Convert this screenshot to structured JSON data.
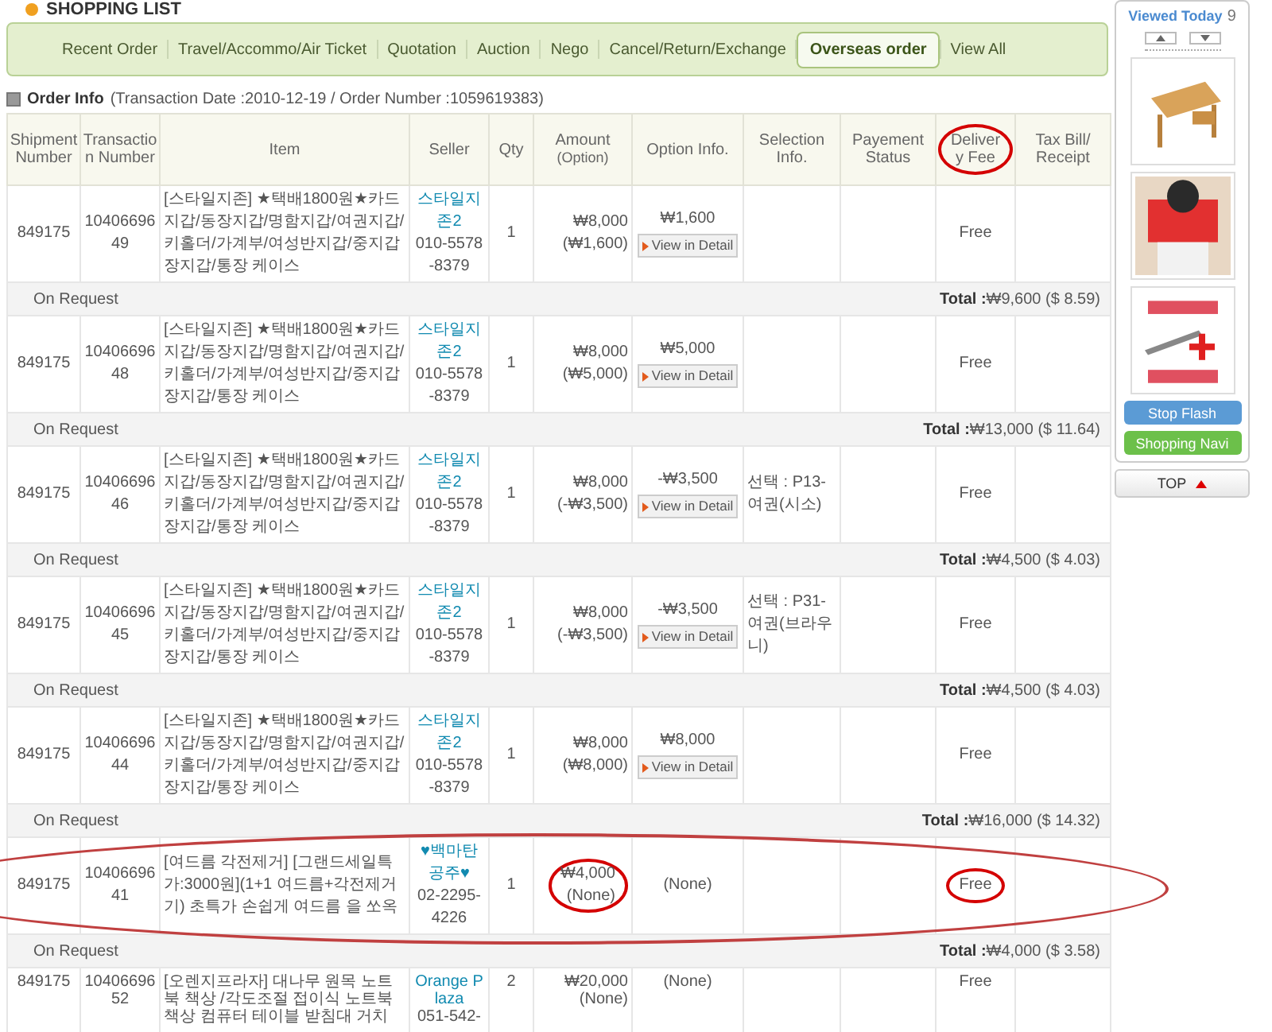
{
  "page_title": "SHOPPING LIST",
  "tabs": [
    {
      "label": "Recent Order",
      "selected": false
    },
    {
      "label": "Travel/Accommo/Air Ticket",
      "selected": false
    },
    {
      "label": "Quotation",
      "selected": false
    },
    {
      "label": "Auction",
      "selected": false
    },
    {
      "label": "Nego",
      "selected": false
    },
    {
      "label": "Cancel/Return/Exchange",
      "selected": false
    },
    {
      "label": "Overseas order",
      "selected": true
    },
    {
      "label": "View All",
      "selected": false
    }
  ],
  "order_info": {
    "label": "Order Info",
    "detail": "(Transaction Date :2010-12-19 / Order Number :1059619383)"
  },
  "columns": [
    {
      "label": "Shipment Number",
      "circled": false
    },
    {
      "label": "Transaction Number",
      "circled": false
    },
    {
      "label": "Item",
      "circled": false
    },
    {
      "label": "Seller",
      "circled": false
    },
    {
      "label": "Qty",
      "circled": false
    },
    {
      "label": "Amount",
      "sub": "(Option)",
      "circled": false
    },
    {
      "label": "Option Info.",
      "circled": false
    },
    {
      "label": "Selection Info.",
      "circled": false
    },
    {
      "label": "Payement Status",
      "circled": false
    },
    {
      "label": "Delivery Fee",
      "circled": true
    },
    {
      "label": "Tax Bill/ Receipt",
      "circled": false
    }
  ],
  "orders": [
    {
      "shipment": "849175",
      "transaction": "1040669649",
      "item": "[스타일지존] ★택배1800원★카드지갑/동장지갑/명함지갑/여권지갑/키홀더/가계부/여성반지갑/중지갑장지갑/통장 케이스",
      "seller": "스타일지존2",
      "phone": "010-5578-8379",
      "qty": "1",
      "amount": "₩8,000",
      "amount_option": "(₩1,600)",
      "option_info": "₩1,600",
      "detail_button": "View in Detail",
      "delivery": "Free",
      "status": "On Request",
      "total_label": "Total :",
      "total": "₩9,600 ($ 8.59)",
      "highlighted": false,
      "amount_circled": false,
      "delivery_circled": false
    },
    {
      "shipment": "849175",
      "transaction": "1040669648",
      "item": "[스타일지존] ★택배1800원★카드지갑/동장지갑/명함지갑/여권지갑/키홀더/가계부/여성반지갑/중지갑장지갑/통장 케이스",
      "seller": "스타일지존2",
      "phone": "010-5578-8379",
      "qty": "1",
      "amount": "₩8,000",
      "amount_option": "(₩5,000)",
      "option_info": "₩5,000",
      "detail_button": "View in Detail",
      "delivery": "Free",
      "status": "On Request",
      "total_label": "Total :",
      "total": "₩13,000 ($ 11.64)",
      "highlighted": false,
      "amount_circled": false,
      "delivery_circled": false
    },
    {
      "shipment": "849175",
      "transaction": "1040669646",
      "item": "[스타일지존] ★택배1800원★카드지갑/동장지갑/명함지갑/여권지갑/키홀더/가계부/여성반지갑/중지갑장지갑/통장 케이스",
      "seller": "스타일지존2",
      "phone": "010-5578-8379",
      "qty": "1",
      "amount": "₩8,000",
      "amount_option": "(-₩3,500)",
      "option_info": "-₩3,500",
      "detail_button": "View in Detail",
      "selection": "선택 : P13-여권(시소)",
      "delivery": "Free",
      "status": "On Request",
      "total_label": "Total :",
      "total": "₩4,500 ($ 4.03)",
      "highlighted": false,
      "amount_circled": false,
      "delivery_circled": false
    },
    {
      "shipment": "849175",
      "transaction": "1040669645",
      "item": "[스타일지존] ★택배1800원★카드지갑/동장지갑/명함지갑/여권지갑/키홀더/가계부/여성반지갑/중지갑장지갑/통장 케이스",
      "seller": "스타일지존2",
      "phone": "010-5578-8379",
      "qty": "1",
      "amount": "₩8,000",
      "amount_option": "(-₩3,500)",
      "option_info": "-₩3,500",
      "detail_button": "View in Detail",
      "selection": "선택 : P31-여권(브라우니)",
      "delivery": "Free",
      "status": "On Request",
      "total_label": "Total :",
      "total": "₩4,500 ($ 4.03)",
      "highlighted": false,
      "amount_circled": false,
      "delivery_circled": false
    },
    {
      "shipment": "849175",
      "transaction": "1040669644",
      "item": "[스타일지존] ★택배1800원★카드지갑/동장지갑/명함지갑/여권지갑/키홀더/가계부/여성반지갑/중지갑장지갑/통장 케이스",
      "seller": "스타일지존2",
      "phone": "010-5578-8379",
      "qty": "1",
      "amount": "₩8,000",
      "amount_option": "(₩8,000)",
      "option_info": "₩8,000",
      "detail_button": "View in Detail",
      "delivery": "Free",
      "status": "On Request",
      "total_label": "Total :",
      "total": "₩16,000 ($ 14.32)",
      "highlighted": false,
      "amount_circled": false,
      "delivery_circled": false
    },
    {
      "shipment": "849175",
      "transaction": "1040669641",
      "item": "[여드름 각전제거] [그랜드세일특가:3000원](1+1 여드름+각전제거기) 초특가 손쉽게 여드름 을 쏘옥",
      "seller": "♥백마탄공주♥",
      "phone": "02-2295-4226",
      "qty": "1",
      "amount": "₩4,000",
      "amount_option": "(None)",
      "option_info": "(None)",
      "delivery": "Free",
      "status": "On Request",
      "total_label": "Total :",
      "total": "₩4,000 ($ 3.58)",
      "highlighted": true,
      "amount_circled": true,
      "delivery_circled": true
    },
    {
      "shipment": "849175",
      "transaction": "1040669652",
      "item": "[오렌지프라자] 대나무 원목 노트북 책상 /각도조절 접이식 노트북 책상 컴퓨터 테이블 받침대 거치",
      "seller": "Orange Plaza",
      "phone": "051-542-",
      "qty": "2",
      "amount": "₩20,000",
      "amount_option": "(None)",
      "option_info": "(None)",
      "delivery": "Free",
      "highlighted": false,
      "amount_circled": false,
      "delivery_circled": false
    }
  ],
  "sidebar": {
    "title": "Viewed Today",
    "count": "9",
    "buttons": [
      {
        "label": "Stop Flash",
        "kind": "blue"
      },
      {
        "label": "Shopping Navi",
        "kind": "green"
      }
    ],
    "top_button": "TOP"
  }
}
